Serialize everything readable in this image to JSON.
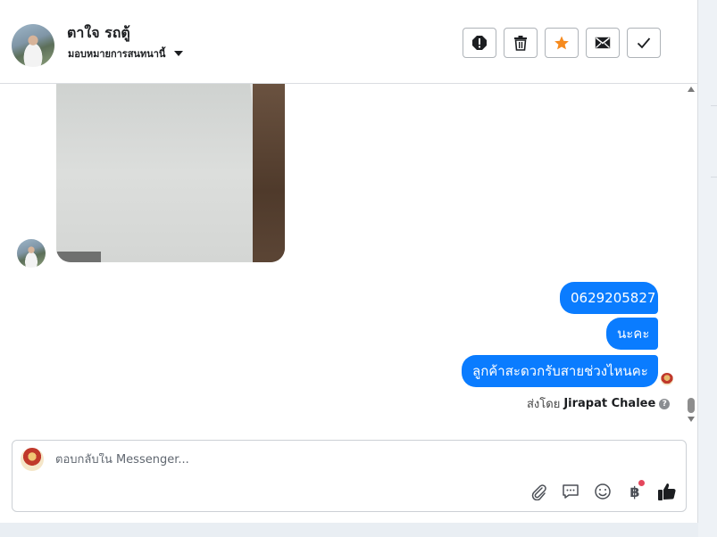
{
  "header": {
    "contact_name": "ตาใจ รถตู้",
    "assign_label": "มอบหมายการสนทนานี้",
    "actions": [
      "spam-icon",
      "trash-icon",
      "star-icon",
      "envelope-icon",
      "check-icon"
    ]
  },
  "conversation": {
    "messages": [
      {
        "text": "0629205827",
        "from": "page"
      },
      {
        "text": "นะคะ",
        "from": "page"
      },
      {
        "text": "ลูกค้าสะดวกรับสายช่วงไหนคะ",
        "from": "page"
      }
    ],
    "sent_by_prefix": "ส่งโดย",
    "sent_by_name": "Jirapat Chalee",
    "bubble_color": "#0a7cff",
    "accent_star": "#f68a1e"
  },
  "composer": {
    "placeholder": "ตอบกลับใน Messenger...",
    "tools": [
      "paperclip-icon",
      "saved-reply-icon",
      "emoji-icon",
      "baht-icon",
      "like-icon"
    ],
    "baht_symbol": "฿"
  }
}
